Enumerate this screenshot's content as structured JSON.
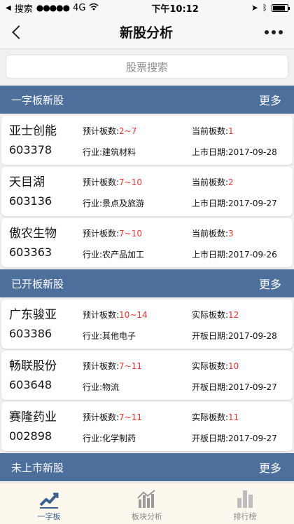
{
  "status": {
    "carrier": "搜索",
    "network": "4G",
    "time": "下午10:12"
  },
  "nav": {
    "title": "新股分析"
  },
  "search": {
    "placeholder": "股票搜索"
  },
  "sections": [
    {
      "title": "一字板新股",
      "more": "更多",
      "stocks": [
        {
          "name": "亚士创能",
          "code": "603378",
          "l1": "预计板数:",
          "v1": "2~7",
          "l2": "行业:建筑材料",
          "l3": "当前板数:",
          "v3": "1",
          "l4": "上市日期:2017-09-28"
        },
        {
          "name": "天目湖",
          "code": "603136",
          "l1": "预计板数:",
          "v1": "7~10",
          "l2": "行业:景点及旅游",
          "l3": "当前板数:",
          "v3": "2",
          "l4": "上市日期:2017-09-27"
        },
        {
          "name": "傲农生物",
          "code": "603363",
          "l1": "预计板数:",
          "v1": "7~10",
          "l2": "行业:农产品加工",
          "l3": "当前板数:",
          "v3": "3",
          "l4": "上市日期:2017-09-26"
        }
      ]
    },
    {
      "title": "已开板新股",
      "more": "更多",
      "stocks": [
        {
          "name": "广东骏亚",
          "code": "603386",
          "l1": "预计板数:",
          "v1": "10~14",
          "l2": "行业:其他电子",
          "l3": "实际板数:",
          "v3": "12",
          "l4": "开板日期:2017-09-28"
        },
        {
          "name": "畅联股份",
          "code": "603648",
          "l1": "预计板数:",
          "v1": "7~11",
          "l2": "行业:物流",
          "l3": "实际板数:",
          "v3": "10",
          "l4": "开板日期:2017-09-27"
        },
        {
          "name": "赛隆药业",
          "code": "002898",
          "l1": "预计板数:",
          "v1": "7~11",
          "l2": "行业:化学制药",
          "l3": "实际板数:",
          "v3": "11",
          "l4": "开板日期:2017-09-27"
        }
      ]
    },
    {
      "title": "未上市新股",
      "more": "更多",
      "stocks": []
    }
  ],
  "tabs": [
    {
      "label": "一字板",
      "icon": "line-chart-icon",
      "active": true
    },
    {
      "label": "板块分析",
      "icon": "bar-line-chart-icon",
      "active": false
    },
    {
      "label": "排行榜",
      "icon": "bar-chart-icon",
      "active": false
    }
  ],
  "colors": {
    "header_blue": "#4d6f9c",
    "value_red": "#e8332f",
    "tab_active": "#3b5f8e",
    "tab_bg": "#fdf8ee"
  }
}
